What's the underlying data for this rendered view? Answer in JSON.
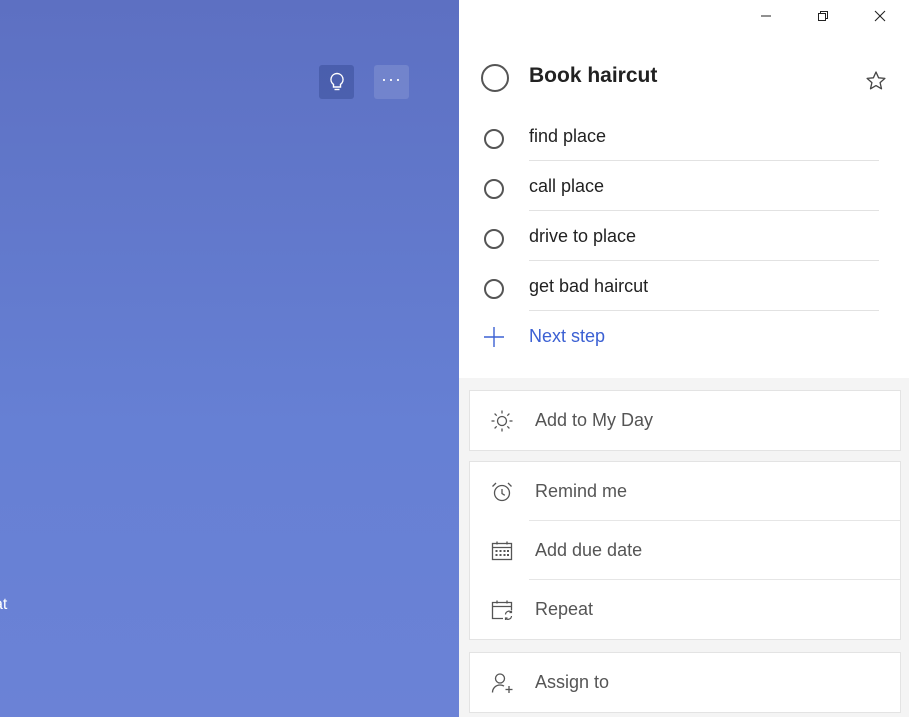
{
  "left": {
    "clipped_text": "at",
    "buttons": {
      "bulb_icon": "lightbulb-icon",
      "more_icon": "more-icon",
      "more_glyph": "···"
    }
  },
  "window": {
    "controls": [
      "minimize-icon",
      "restore-icon",
      "close-icon"
    ]
  },
  "task": {
    "title": "Book haircut",
    "important_icon": "star-icon",
    "steps": [
      {
        "label": "find place"
      },
      {
        "label": "call place"
      },
      {
        "label": "drive to place"
      },
      {
        "label": "get bad haircut"
      }
    ],
    "next_step_label": "Next step"
  },
  "details": {
    "my_day": {
      "label": "Add to My Day",
      "icon": "sun-icon"
    },
    "remind": {
      "label": "Remind me",
      "icon": "alarm-clock-icon"
    },
    "due": {
      "label": "Add due date",
      "icon": "calendar-icon"
    },
    "repeat": {
      "label": "Repeat",
      "icon": "repeat-calendar-icon"
    },
    "assign": {
      "label": "Assign to",
      "icon": "assign-person-icon"
    }
  },
  "colors": {
    "accent": "#3b60d3",
    "background_gradient_top": "#5d70c2",
    "background_gradient_bottom": "#6b82d6"
  }
}
